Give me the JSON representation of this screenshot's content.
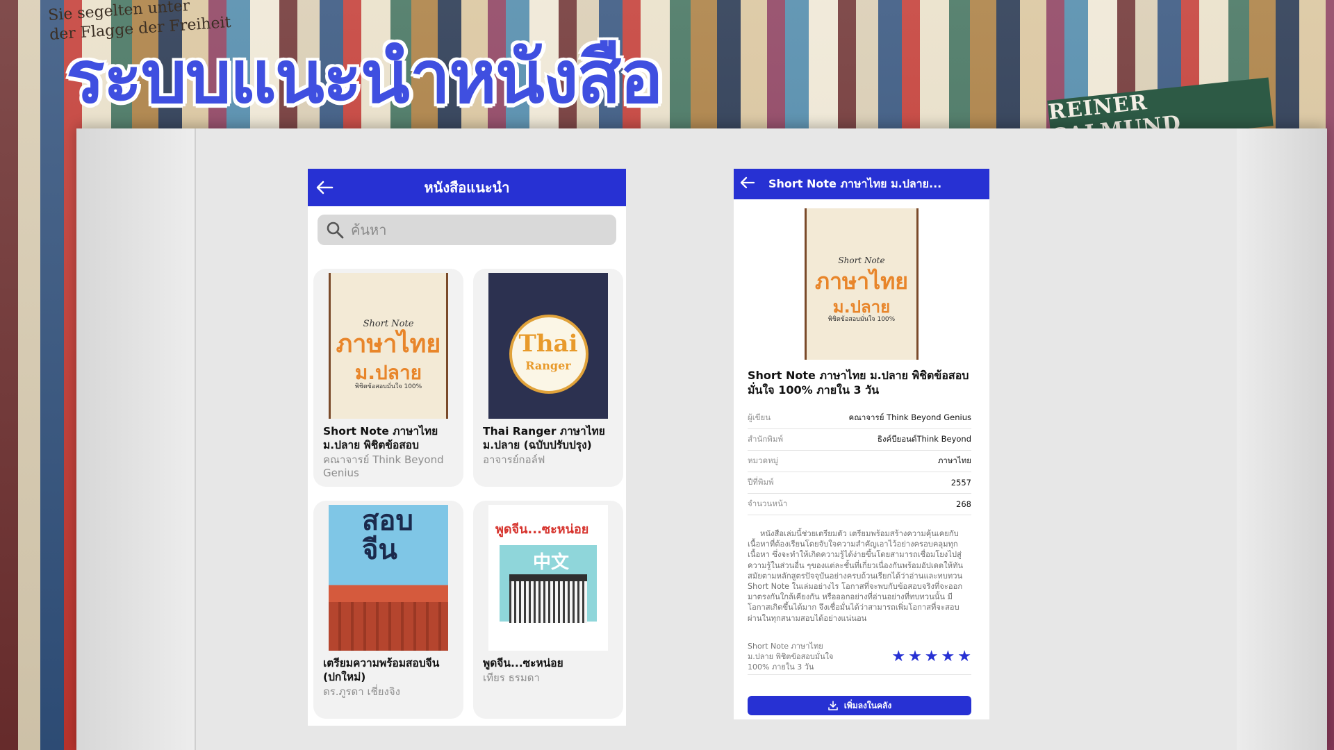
{
  "headline": "ระบบแนะนำหนังสือ",
  "background": {
    "left_text": "Sie segelten unter\nder Flagge der Freiheit",
    "tilted_book": "REINER CALMUND"
  },
  "list_screen": {
    "title": "หนังสือแนะนำ",
    "search_placeholder": "ค้นหา",
    "books": [
      {
        "title": "Short Note ภาษาไทย ม.ปลาย พิชิตข้อสอบ",
        "author": "คณาจารย์ Think Beyond Genius",
        "cover": {
          "small": "Short Note",
          "line1": "ภาษาไทย",
          "line2": "ม.ปลาย",
          "line3": "พิชิตข้อสอบมั่นใจ 100%"
        }
      },
      {
        "title": "Thai Ranger ภาษาไทย ม.ปลาย (ฉบับปรับปรุง)",
        "author": "อาจารย์กอล์ฟ",
        "cover": {
          "line1": "Thai",
          "line2": "Ranger"
        }
      },
      {
        "title": "เตรียมความพร้อมสอบจีน (ปกใหม่)",
        "author": "ดร.ภูรดา เชี่ยงจิง",
        "cover": {
          "line1": "สอบ",
          "line2": "จีน"
        }
      },
      {
        "title": "พูดจีน...ซะหน่อย",
        "author": "เทียร ธรมดา",
        "cover": {
          "line1": "พูดจีน...ซะหน่อย",
          "line2": "中文"
        }
      }
    ]
  },
  "detail_screen": {
    "bar_title": "Short Note ภาษาไทย ม.ปลาย...",
    "title": "Short Note ภาษาไทย ม.ปลาย พิชิตข้อสอบมั่นใจ 100% ภายใน 3 วัน",
    "cover": {
      "small": "Short Note",
      "line1": "ภาษาไทย",
      "line2": "ม.ปลาย",
      "line3": "พิชิตข้อสอบมั่นใจ 100%"
    },
    "meta": [
      {
        "key": "ผู้เขียน",
        "value": "คณาจารย์ Think Beyond Genius"
      },
      {
        "key": "สำนักพิมพ์",
        "value": "ธิงค์บียอนด์Think Beyond"
      },
      {
        "key": "หมวดหมู่",
        "value": "ภาษาไทย"
      },
      {
        "key": "ปีที่พิมพ์",
        "value": "2557"
      },
      {
        "key": "จำนวนหน้า",
        "value": "268"
      }
    ],
    "description": "หนังสือเล่มนี้ช่วยเตรียมตัว เตรียมพร้อมสร้างความคุ้นเคยกับเนื้อหาที่ต้องเรียนโดยจับใจความสำคัญเอาไว้อย่างครอบคลุมทุกเนื้อหา ซึ่งจะทำให้เกิดความรู้ได้ง่ายขึ้นโดยสามารถเชื่อมโยงไปสู่ความรู้ในส่วนอื่น ๆของแต่ละชั้นที่เกี่ยวเนื่องกันพร้อมอัปเดตให้ทันสมัยตามหลักสูตรปัจจุบันอย่างครบถ้วนเรียกได้ว่าอ่านและทบทวน Short Note ในเล่มอย่างไร โอกาสที่จะพบกับข้อสอบจริงที่จะออกมาตรงกันใกล้เคียงกัน หรือออกอย่างที่อ่านอย่างที่ทบทวนนั้น มีโอกาสเกิดขึ้นได้มาก จึงเชื่อมั่นได้ว่าสามารถเพิ่มโอกาสที่จะสอบผ่านในทุกสนามสอบได้อย่างแน่นอน",
    "rating_label": "Short Note ภาษาไทย ม.ปลาย พิชิตข้อสอบมั่นใจ 100% ภายใน 3 วัน",
    "rating_stars": 5,
    "add_button": "เพิ่มลงในคลัง"
  },
  "colors": {
    "primary": "#2731d3",
    "headline": "#3f4fe0"
  },
  "icons": [
    "back-arrow-icon",
    "search-icon",
    "star-icon",
    "download-icon"
  ]
}
